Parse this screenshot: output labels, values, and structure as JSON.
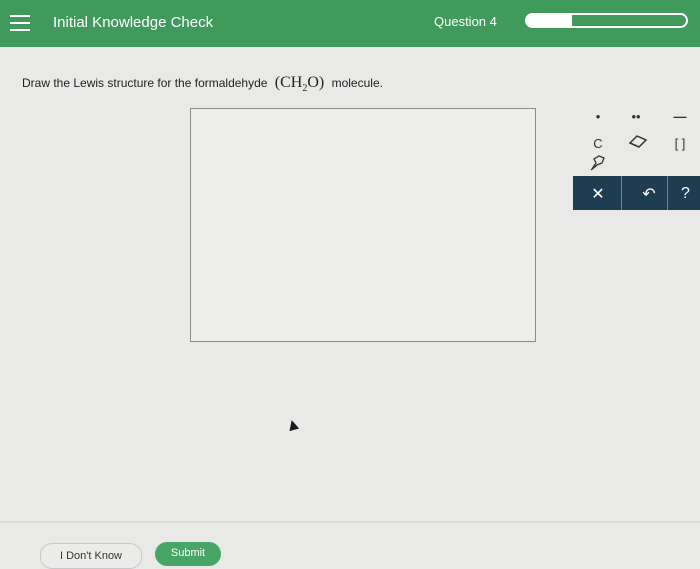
{
  "header": {
    "title": "Initial Knowledge Check",
    "question_label": "Question 4",
    "progress_fraction": 0.28,
    "menu_icon": "hamburger-menu-icon"
  },
  "question": {
    "prompt_before": "Draw the Lewis structure for the formaldehyde",
    "formula_main": "CH",
    "formula_sub": "2",
    "formula_end": "O",
    "prompt_after": "molecule."
  },
  "palette": {
    "single_dot": "•",
    "double_dot": "••",
    "bond": "—",
    "atom_label": "C",
    "brackets": "[ ]",
    "eraser_icon": "eraser-icon",
    "template_icon": "template-icon",
    "clear": "✕",
    "undo": "↶",
    "help": "?"
  },
  "footer": {
    "dont_know_label": "I Don't Know",
    "submit_label": "Submit"
  },
  "colors": {
    "header_green": "#3f9a5c",
    "submit_green": "#47a666",
    "toolbar_dark": "#1f3d50"
  }
}
